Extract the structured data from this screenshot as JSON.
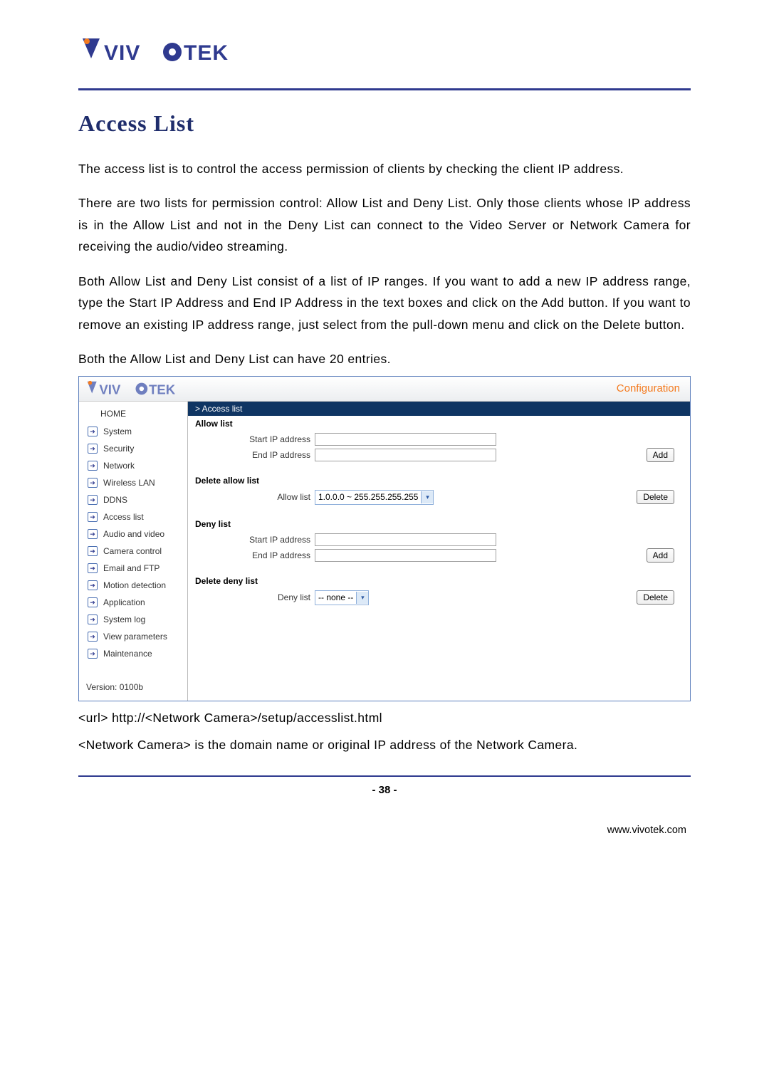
{
  "header": {
    "brand": "VIVOTEK"
  },
  "title": "Access List",
  "body_paragraphs": [
    "The access list is to control the access permission of clients by checking the client IP address.",
    "There are two lists for permission control: Allow List and Deny List. Only those clients whose IP address is in the Allow List and not in the Deny List can connect to the Video Server or Network Camera for receiving the audio/video streaming.",
    "Both Allow List and Deny List consist of a list of IP ranges. If you want to add a new IP address range, type the Start IP Address and End IP Address in the text boxes and click on the Add button. If you want to remove an existing IP address range, just select from the pull-down menu and click on the Delete button.",
    "Both the Allow List and Deny List can have 20 entries."
  ],
  "config": {
    "brand": "VIVOTEK",
    "header_right": "Configuration",
    "breadcrumb": "> Access list",
    "nav": {
      "home": "HOME",
      "items": [
        "System",
        "Security",
        "Network",
        "Wireless LAN",
        "DDNS",
        "Access list",
        "Audio and video",
        "Camera control",
        "Email and FTP",
        "Motion detection",
        "Application",
        "System log",
        "View parameters",
        "Maintenance"
      ],
      "version": "Version: 0100b"
    },
    "allow": {
      "title": "Allow list",
      "start_label": "Start IP address",
      "end_label": "End IP address",
      "add_btn": "Add",
      "del_title": "Delete allow list",
      "del_label": "Allow list",
      "del_value": "1.0.0.0 ~ 255.255.255.255",
      "del_btn": "Delete"
    },
    "deny": {
      "title": "Deny list",
      "start_label": "Start IP address",
      "end_label": "End IP address",
      "add_btn": "Add",
      "del_title": "Delete deny list",
      "del_label": "Deny list",
      "del_value": " -- none -- ",
      "del_btn": "Delete"
    }
  },
  "footnotes": [
    "<url> http://<Network Camera>/setup/accesslist.html",
    "<Network Camera> is the domain name or original IP address of the Network Camera."
  ],
  "page_number": "- 38 -",
  "footer_url": "www.vivotek.com"
}
